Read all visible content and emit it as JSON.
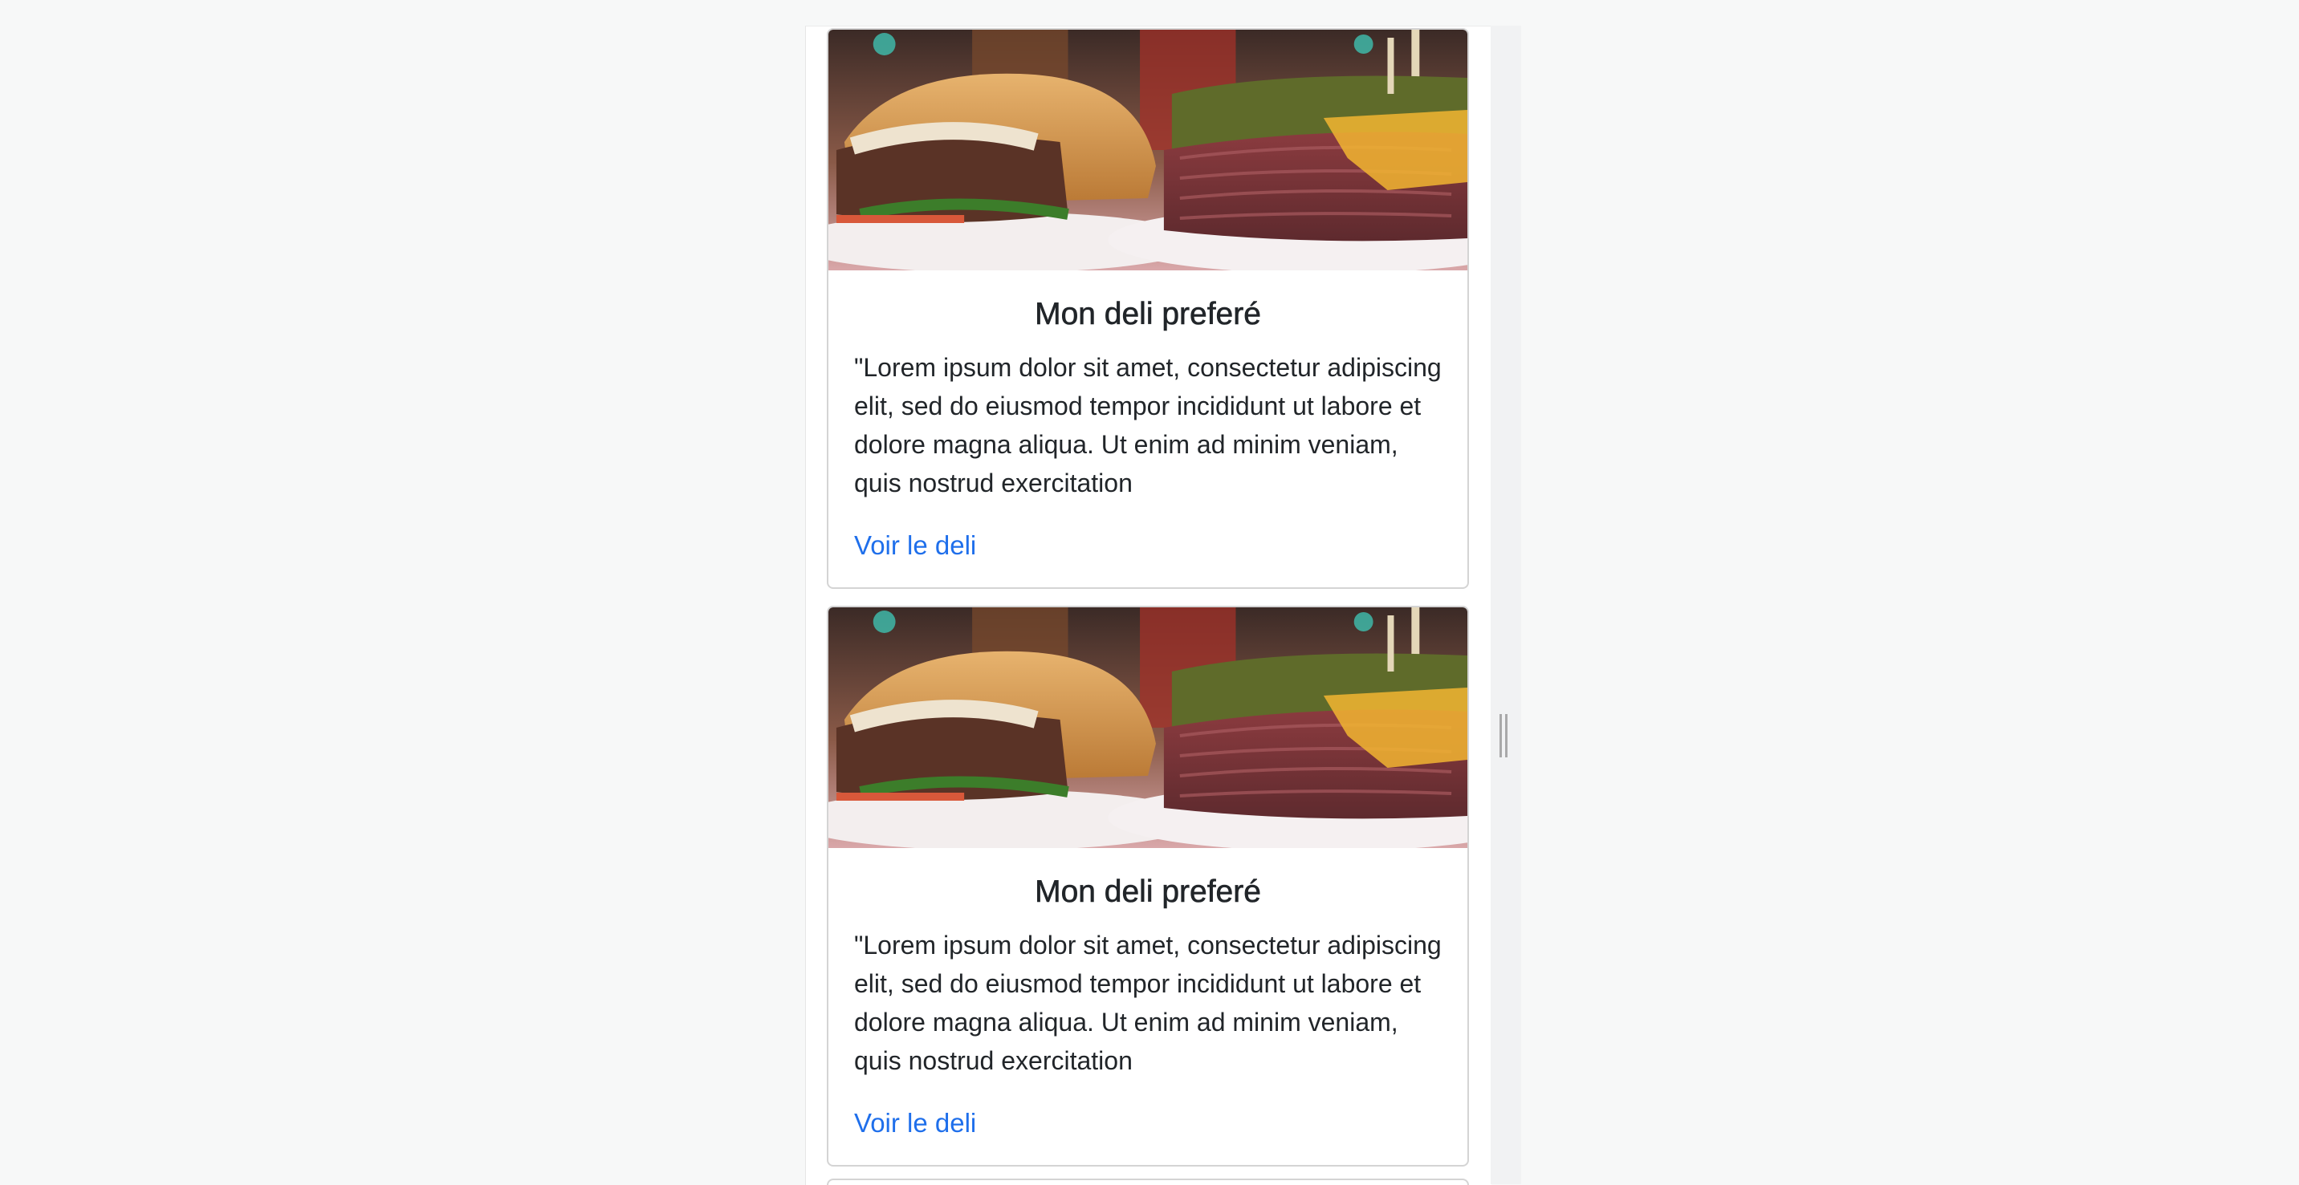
{
  "cards": [
    {
      "title": "Mon deli preferé",
      "text": "\"Lorem ipsum dolor sit amet, consectetur adipiscing elit, sed do eiusmod tempor incididunt ut labore et dolore magna aliqua. Ut enim ad minim veniam, quis nostrud exercitation",
      "link": "Voir le deli",
      "image_icon": "burger-and-pastrami-sandwich-photo"
    },
    {
      "title": "Mon deli preferé",
      "text": "\"Lorem ipsum dolor sit amet, consectetur adipiscing elit, sed do eiusmod tempor incididunt ut labore et dolore magna aliqua. Ut enim ad minim veniam, quis nostrud exercitation",
      "link": "Voir le deli",
      "image_icon": "burger-and-pastrami-sandwich-photo"
    }
  ],
  "colors": {
    "link": "#1f6feb",
    "text": "#212529",
    "border": "#d4d4d4",
    "page_background": "#f7f8f8"
  }
}
